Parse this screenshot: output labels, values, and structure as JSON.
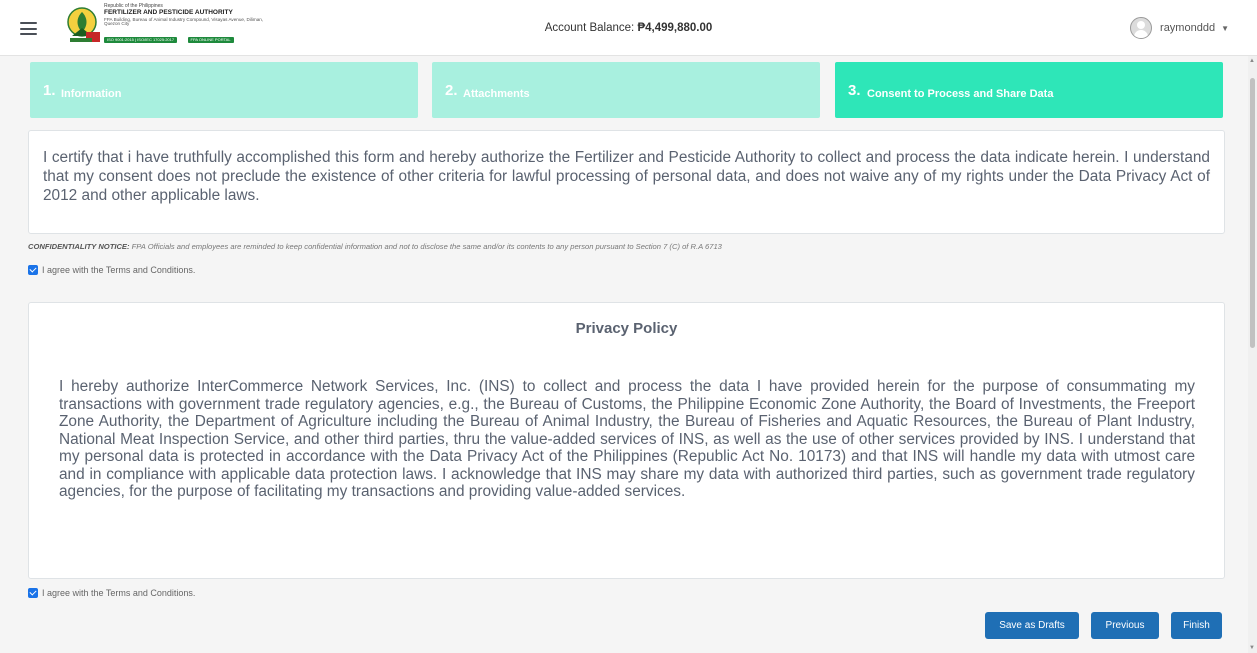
{
  "header": {
    "agency_line1": "Republic of the Philippines",
    "agency_name": "FERTILIZER AND PESTICIDE AUTHORITY",
    "agency_address": "FPA Building, Bureau of Animal Industry Compound, Visayas Avenue, Diliman, Quezon City",
    "badge1": "ISO 9001:2015 | ISO/IEC 17025:2017",
    "badge2": "FPA ONLINE PORTAL",
    "balance_label": "Account Balance:",
    "balance_value": "₱4,499,880.00",
    "username": "raymonddd",
    "caret": "▼",
    "menu_icon": "hamburger-icon",
    "user_icon": "user-avatar-icon"
  },
  "steps": [
    {
      "num": "1.",
      "label": "Information",
      "active": false
    },
    {
      "num": "2.",
      "label": "Attachments",
      "active": false
    },
    {
      "num": "3.",
      "label": "Consent to Process and Share Data",
      "active": true
    }
  ],
  "certification": {
    "text": "I certify that i have truthfully accomplished this form and hereby authorize the Fertilizer and Pesticide Authority to collect and process the data indicate herein. I understand that my consent does not preclude the existence of other criteria for lawful processing of personal data, and does not waive any of my rights under the Data Privacy Act of 2012 and other applicable laws."
  },
  "notice": {
    "label": "CONFIDENTIALITY NOTICE:",
    "text": "FPA Officials and employees are reminded to keep confidential information and not to disclose the same and/or its contents to any person pursuant to Section 7 (C) of R.A 6713"
  },
  "agree_label": "I agree with the Terms and Conditions.",
  "privacy": {
    "title": "Privacy Policy",
    "text": "I hereby authorize InterCommerce Network Services, Inc. (INS) to collect and process the data I have provided herein for the purpose of consummating my transactions with government trade regulatory agencies, e.g., the Bureau of Customs, the Philippine Economic Zone Authority, the Board of Investments, the Freeport Zone Authority, the Department of Agriculture including the Bureau of Animal Industry, the Bureau of Fisheries and Aquatic Resources, the Bureau of Plant Industry, National Meat Inspection Service, and other third parties, thru the value-added services of INS, as well as the use of other services provided by INS. I understand that my personal data is protected in accordance with the Data Privacy Act of the Philippines (Republic Act No. 10173) and that INS will handle my data with utmost care and in compliance with applicable data protection laws. I acknowledge that INS may share my data with authorized third parties, such as government trade regulatory agencies, for the purpose of facilitating my transactions and providing value-added services."
  },
  "buttons": {
    "drafts": "Save as Drafts",
    "previous": "Previous",
    "finish": "Finish"
  },
  "colors": {
    "step_inactive": "#a8f0df",
    "step_active": "#2ee6b8",
    "button": "#1f6fb5",
    "checkbox": "#1a73e8"
  }
}
